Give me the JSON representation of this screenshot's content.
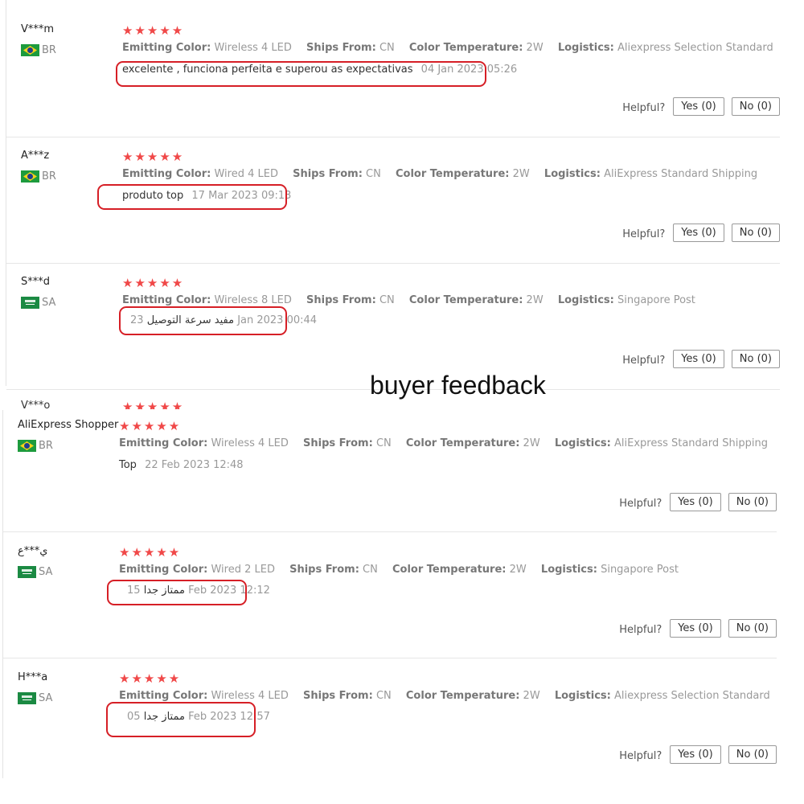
{
  "overlay_title": "buyer feedback",
  "helpful_label": "Helpful?",
  "stars_text": "★★★★★",
  "attr_labels": {
    "emitting_color": "Emitting Color:",
    "ships_from": "Ships From:",
    "color_temperature": "Color Temperature:",
    "logistics": "Logistics:"
  },
  "peek": {
    "user": "V***o",
    "stars": "★★★★★"
  },
  "reviews": [
    {
      "user": "V***m",
      "country": "BR",
      "rating": 5,
      "emitting_color": "Wireless 4 LED",
      "ships_from": "CN",
      "color_temperature": "2W",
      "logistics": "Aliexpress Selection Standard",
      "comment": "excelente , funciona perfeita e superou as expectativas",
      "date": "04 Jan 2023 05:26",
      "yes_label": "Yes (0)",
      "no_label": "No (0)"
    },
    {
      "user": "A***z",
      "country": "BR",
      "rating": 5,
      "emitting_color": "Wired 4 LED",
      "ships_from": "CN",
      "color_temperature": "2W",
      "logistics": "AliExpress Standard Shipping",
      "comment": "produto top",
      "date": "17 Mar 2023 09:13",
      "yes_label": "Yes (0)",
      "no_label": "No (0)"
    },
    {
      "user": "S***d",
      "country": "SA",
      "rating": 5,
      "emitting_color": "Wireless 8 LED",
      "ships_from": "CN",
      "color_temperature": "2W",
      "logistics": "Singapore Post",
      "comment": "مفيد سرعة التوصيل",
      "date": "23 Jan 2023 00:44",
      "yes_label": "Yes (0)",
      "no_label": "No (0)"
    },
    {
      "user": "AliExpress Shopper",
      "country": "BR",
      "rating": 5,
      "emitting_color": "Wireless 4 LED",
      "ships_from": "CN",
      "color_temperature": "2W",
      "logistics": "AliExpress Standard Shipping",
      "comment": "Top",
      "date": "22 Feb 2023 12:48",
      "yes_label": "Yes (0)",
      "no_label": "No (0)"
    },
    {
      "user": "ي***ع",
      "country": "SA",
      "rating": 5,
      "emitting_color": "Wired 2 LED",
      "ships_from": "CN",
      "color_temperature": "2W",
      "logistics": "Singapore Post",
      "comment": "ممتاز جدا",
      "date": "15 Feb 2023 12:12",
      "yes_label": "Yes (0)",
      "no_label": "No (0)"
    },
    {
      "user": "H***a",
      "country": "SA",
      "rating": 5,
      "emitting_color": "Wireless 4 LED",
      "ships_from": "CN",
      "color_temperature": "2W",
      "logistics": "Aliexpress Selection Standard",
      "comment": "ممتاز جدا",
      "date": "05 Feb 2023 12:57",
      "yes_label": "Yes (0)",
      "no_label": "No (0)"
    }
  ]
}
